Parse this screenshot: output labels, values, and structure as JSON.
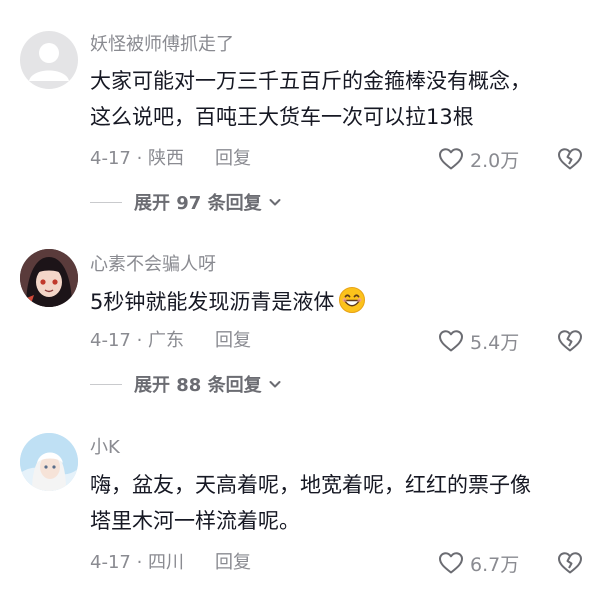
{
  "comments": [
    {
      "username": "妖怪被师傅抓走了",
      "text_line1": "大家可能对一万三千五百斤的金箍棒没有概念，",
      "text_line2": "这么说吧，百吨王大货车一次可以拉13根",
      "date_location": "4-17 · 陕西",
      "reply_label": "回复",
      "likes": "2.0万",
      "expand_label": "展开 97 条回复"
    },
    {
      "username": "心素不会骗人呀",
      "text_line1": "5秒钟就能发现沥青是液体",
      "date_location": "4-17 · 广东",
      "reply_label": "回复",
      "likes": "5.4万",
      "expand_label": "展开 88 条回复"
    },
    {
      "username": "小K",
      "text_line1": "嗨，盆友，天高着呢，地宽着呢，红红的票子像",
      "text_line2": "塔里木河一样流着呢。",
      "date_location": "4-17 · 四川",
      "reply_label": "回复",
      "likes": "6.7万"
    }
  ],
  "icons": {
    "like": "heart-outline-icon",
    "dislike": "broken-heart-icon",
    "expand": "chevron-down-icon",
    "emoji": "grinning-face-emoji"
  },
  "colors": {
    "text_primary": "#161823",
    "text_secondary": "#8a8b91",
    "background": "#ffffff"
  }
}
